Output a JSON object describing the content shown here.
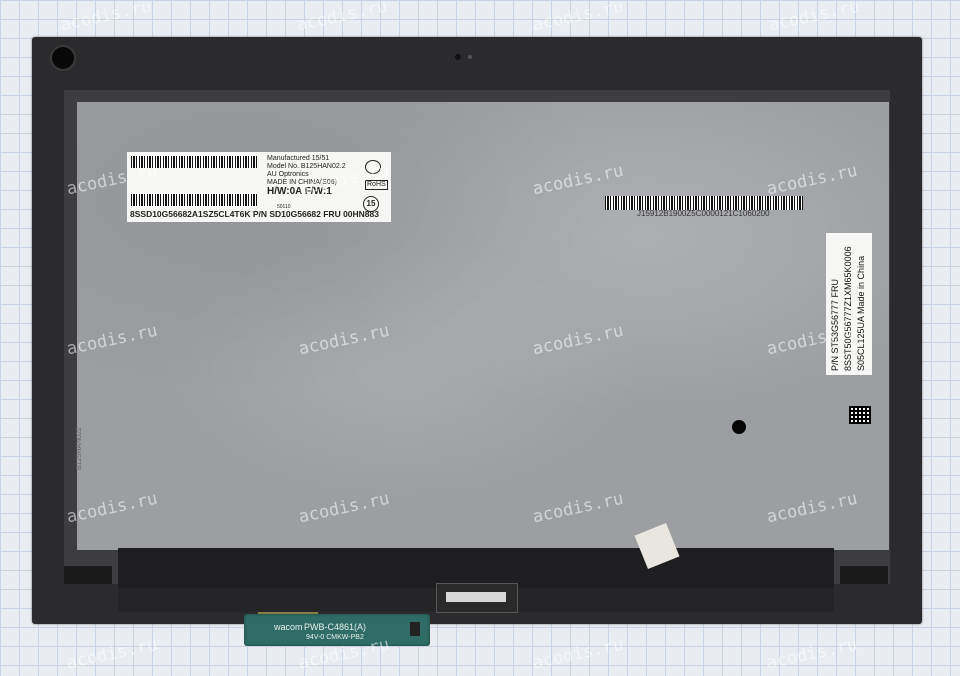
{
  "watermark": "acodis.ru",
  "panel_label": {
    "manufactured": "Manufactured 15/51",
    "model_no": "Model No. B125HAN02.2",
    "vendor": "AU Optronics",
    "made_in": "MADE IN CHINA(S06)",
    "hw_fw": "H/W:0A  F/W:1",
    "rohs": "RoHS",
    "barcode_text": "8SSD10G56682A1SZ5CL4T6K  P/N SD10G56682  FRU 00HN883",
    "small_code": "50110"
  },
  "panel_serial": "J15912B1900Z5C0000121C1060200",
  "fru_label": {
    "line1": "P/N  ST53G56777    FRU",
    "line2": "8SST50G56777Z1XM65K0006",
    "line3": "S05CL125UA  Made in China"
  },
  "side_code": "B125HAN022",
  "pcb": {
    "brand": "wacom",
    "model": "PWB-C4861(A)",
    "rating": "94V-0  CMKW-PB2"
  }
}
